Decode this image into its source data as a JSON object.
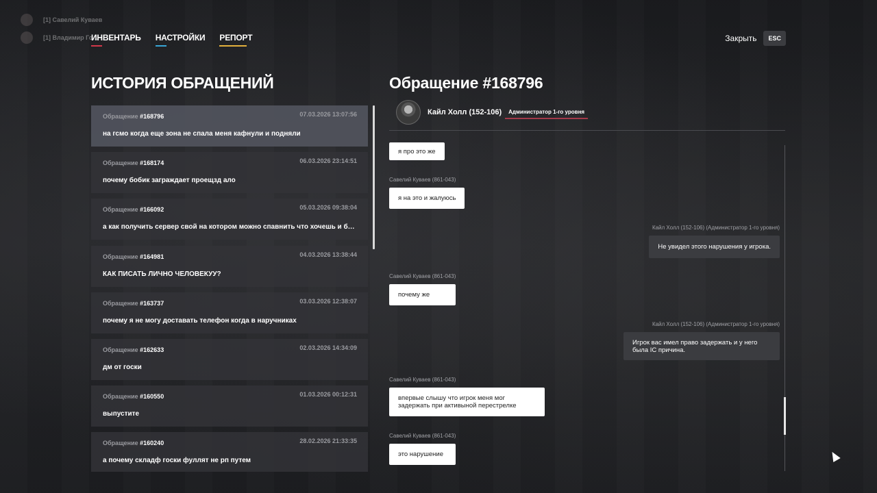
{
  "game_chat": [
    {
      "text": "[1] Савелий Куваев"
    },
    {
      "text": "[1] Владимир Го..."
    }
  ],
  "nav": {
    "tabs": [
      {
        "label": "ИНВЕНТАРЬ",
        "underline_color": "#d2384a",
        "underline_width": 16
      },
      {
        "label": "НАСТРОЙКИ",
        "underline_color": "#38a7d8",
        "underline_width": 16
      },
      {
        "label": "РЕПОРТ",
        "underline_color": "#e4b13c",
        "underline_width": 40
      }
    ],
    "close_label": "Закрыть",
    "close_key": "ESC"
  },
  "history": {
    "title": "ИСТОРИЯ ОБРАЩЕНИЙ",
    "prefix": "Обращение",
    "items": [
      {
        "num": "#168796",
        "date": "07.03.2026 13:07:56",
        "msg": "на гсмо когда еще зона не спала меня кафнули и подняли",
        "active": true
      },
      {
        "num": "#168174",
        "date": "06.03.2026 23:14:51",
        "msg": "почему бобик заграждает проещзд ало",
        "active": false
      },
      {
        "num": "#166092",
        "date": "05.03.2026 09:38:04",
        "msg": "а как получить сервер свой на котором можно спавнить что хочешь и быть а...",
        "active": false
      },
      {
        "num": "#164981",
        "date": "04.03.2026 13:38:44",
        "msg": "КАК ПИСАТЬ ЛИЧНО ЧЕЛОВЕКУУ?",
        "active": false
      },
      {
        "num": "#163737",
        "date": "03.03.2026 12:38:07",
        "msg": "почему я не могу доставать телефон когда в наручниках",
        "active": false
      },
      {
        "num": "#162633",
        "date": "02.03.2026 14:34:09",
        "msg": "дм от госки",
        "active": false
      },
      {
        "num": "#160550",
        "date": "01.03.2026 00:12:31",
        "msg": "выпустите",
        "active": false
      },
      {
        "num": "#160240",
        "date": "28.02.2026 21:33:35",
        "msg": "а почему складф госки фуллят не рп путем",
        "active": false
      }
    ]
  },
  "request": {
    "title": "Обращение #168796",
    "admin_name": "Кайл Холл (152-106)",
    "admin_role": "Администратор 1-го уровня",
    "role_underline_color": "#a33a4a"
  },
  "chat": {
    "messages": [
      {
        "side": "user",
        "author": "",
        "text": "я про это же"
      },
      {
        "side": "user",
        "author": "Савелий Куваев (861-043)",
        "text": "я на это и жалуюсь"
      },
      {
        "side": "admin",
        "author": "Кайл Холл (152-106) (Администратор 1-го уровня)",
        "text": "Не увидел этого нарушения у игрока."
      },
      {
        "side": "user",
        "author": "Савелий Куваев (861-043)",
        "text": "почему же"
      },
      {
        "side": "admin",
        "author": "Кайл Холл (152-106) (Администратор 1-го уровня)",
        "text": "Игрок вас имел право задержать и у него была IC причина."
      },
      {
        "side": "user",
        "author": "Савелий Куваев (861-043)",
        "text": "впервые слышу что игрок меня мог задержать при активыной перестрелке"
      },
      {
        "side": "user",
        "author": "Савелий Куваев (861-043)",
        "text": "это нарушение"
      }
    ]
  }
}
